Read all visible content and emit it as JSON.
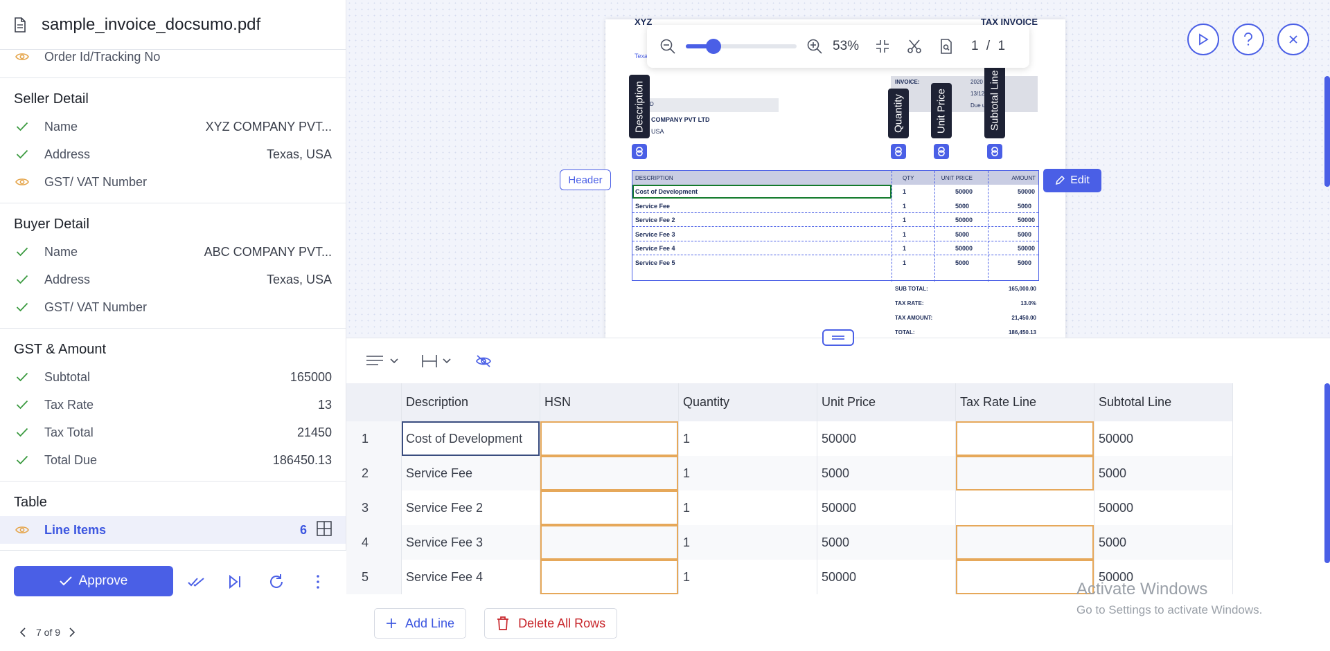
{
  "file": {
    "name": "sample_invoice_docsumo.pdf"
  },
  "top_row": {
    "label": "Order Id/Tracking No",
    "status": "review"
  },
  "sections": {
    "seller": {
      "title": "Seller Detail",
      "items": [
        {
          "label": "Name",
          "value": "XYZ COMPANY PVT...",
          "status": "ok"
        },
        {
          "label": "Address",
          "value": "Texas, USA",
          "status": "ok"
        },
        {
          "label": "GST/ VAT Number",
          "value": "",
          "status": "review"
        }
      ]
    },
    "buyer": {
      "title": "Buyer Detail",
      "items": [
        {
          "label": "Name",
          "value": "ABC COMPANY PVT...",
          "status": "ok"
        },
        {
          "label": "Address",
          "value": "Texas, USA",
          "status": "ok"
        },
        {
          "label": "GST/ VAT Number",
          "value": "",
          "status": "ok"
        }
      ]
    },
    "amount": {
      "title": "GST & Amount",
      "items": [
        {
          "label": "Subtotal",
          "value": "165000",
          "status": "ok"
        },
        {
          "label": "Tax Rate",
          "value": "13",
          "status": "ok"
        },
        {
          "label": "Tax Total",
          "value": "21450",
          "status": "ok"
        },
        {
          "label": "Total Due",
          "value": "186450.13",
          "status": "ok"
        }
      ]
    },
    "table": {
      "title": "Table",
      "line_items": {
        "label": "Line Items",
        "count": "6"
      }
    }
  },
  "footer": {
    "approve_label": "Approve",
    "pager": "7 of 9"
  },
  "viewer": {
    "zoom": "53%",
    "zoom_fraction": 0.25,
    "page_current": "1",
    "page_sep": "/",
    "page_total": "1",
    "header_tag": "Header",
    "edit_label": "Edit",
    "column_tags": [
      "Description",
      "Quantity",
      "Unit Price",
      "Subtotal Line"
    ],
    "document": {
      "company": "XYZ",
      "company_sub": "Texa",
      "doc_title": "TAX INVOICE",
      "invoice_label": "INVOICE:",
      "invoice_value": "2020",
      "date_value": "13/12",
      "terms_label": "S:",
      "terms_value": "Due u     pt",
      "to_label": "D",
      "buyer_name": "COMPANY PVT LTD",
      "buyer_addr": "USA",
      "table_headers": [
        "DESCRIPTION",
        "QTY",
        "UNIT PRICE",
        "AMOUNT"
      ],
      "table_rows": [
        [
          "Cost of Development",
          "1",
          "50000",
          "50000"
        ],
        [
          "Service Fee",
          "1",
          "5000",
          "5000"
        ],
        [
          "Service Fee 2",
          "1",
          "50000",
          "50000"
        ],
        [
          "Service Fee 3",
          "1",
          "5000",
          "5000"
        ],
        [
          "Service Fee 4",
          "1",
          "50000",
          "50000"
        ],
        [
          "Service Fee 5",
          "1",
          "5000",
          "5000"
        ]
      ],
      "totals": [
        [
          "SUB TOTAL:",
          "165,000.00"
        ],
        [
          "TAX RATE:",
          "13.0%"
        ],
        [
          "TAX AMOUNT:",
          "21,450.00"
        ],
        [
          "TOTAL:",
          "186,450.13"
        ]
      ]
    }
  },
  "grid": {
    "columns": [
      "Description",
      "HSN",
      "Quantity",
      "Unit Price",
      "Tax Rate Line",
      "Subtotal Line"
    ],
    "rows": [
      {
        "idx": "1",
        "cells": [
          "Cost of Development",
          "",
          "1",
          "50000",
          "",
          "50000"
        ]
      },
      {
        "idx": "2",
        "cells": [
          "Service Fee",
          "",
          "1",
          "5000",
          "",
          "5000"
        ]
      },
      {
        "idx": "3",
        "cells": [
          "Service Fee 2",
          "",
          "1",
          "50000",
          "",
          "50000"
        ]
      },
      {
        "idx": "4",
        "cells": [
          "Service Fee 3",
          "",
          "1",
          "5000",
          "",
          "5000"
        ]
      },
      {
        "idx": "5",
        "cells": [
          "Service Fee 4",
          "",
          "1",
          "50000",
          "",
          "50000"
        ]
      }
    ],
    "add_line_label": "Add Line",
    "delete_rows_label": "Delete All Rows"
  },
  "watermark": {
    "line1": "Activate Windows",
    "line2": "Go to Settings to activate Windows."
  },
  "colors": {
    "accent": "#4a5fe6",
    "ok": "#3a9a3f",
    "review": "#e5a54b",
    "danger": "#c8262b"
  }
}
